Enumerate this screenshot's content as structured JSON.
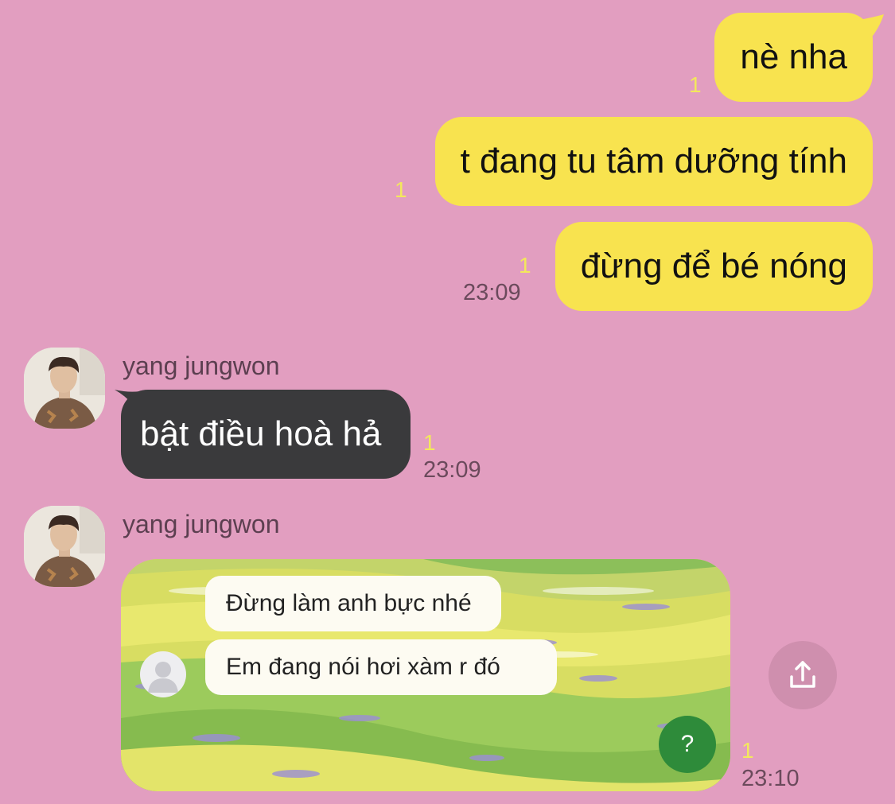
{
  "messages_out": [
    {
      "text": "nè nha",
      "read": "1"
    },
    {
      "text": "t đang tu tâm dưỡng tính",
      "read": "1"
    },
    {
      "text": "đừng để bé nóng",
      "read": "1",
      "time": "23:09"
    }
  ],
  "message_in_1": {
    "sender": "yang jungwon",
    "text": "bật điều hoà hả",
    "read": "1",
    "time": "23:09"
  },
  "message_in_2": {
    "sender": "yang jungwon",
    "image_texts": [
      "Đừng làm anh bực nhé",
      "Em đang nói hơi xàm r đó"
    ],
    "help_icon_text": "?",
    "read": "1",
    "time": "23:10"
  },
  "icons": {
    "share": "share-icon",
    "avatar": "avatar-photo",
    "placeholder_avatar": "person-icon",
    "help": "help-icon"
  },
  "colors": {
    "background": "#e29ec0",
    "outgoing_bubble": "#f8e34f",
    "incoming_bubble": "#3a3a3c",
    "read_count": "#f3e85c"
  }
}
